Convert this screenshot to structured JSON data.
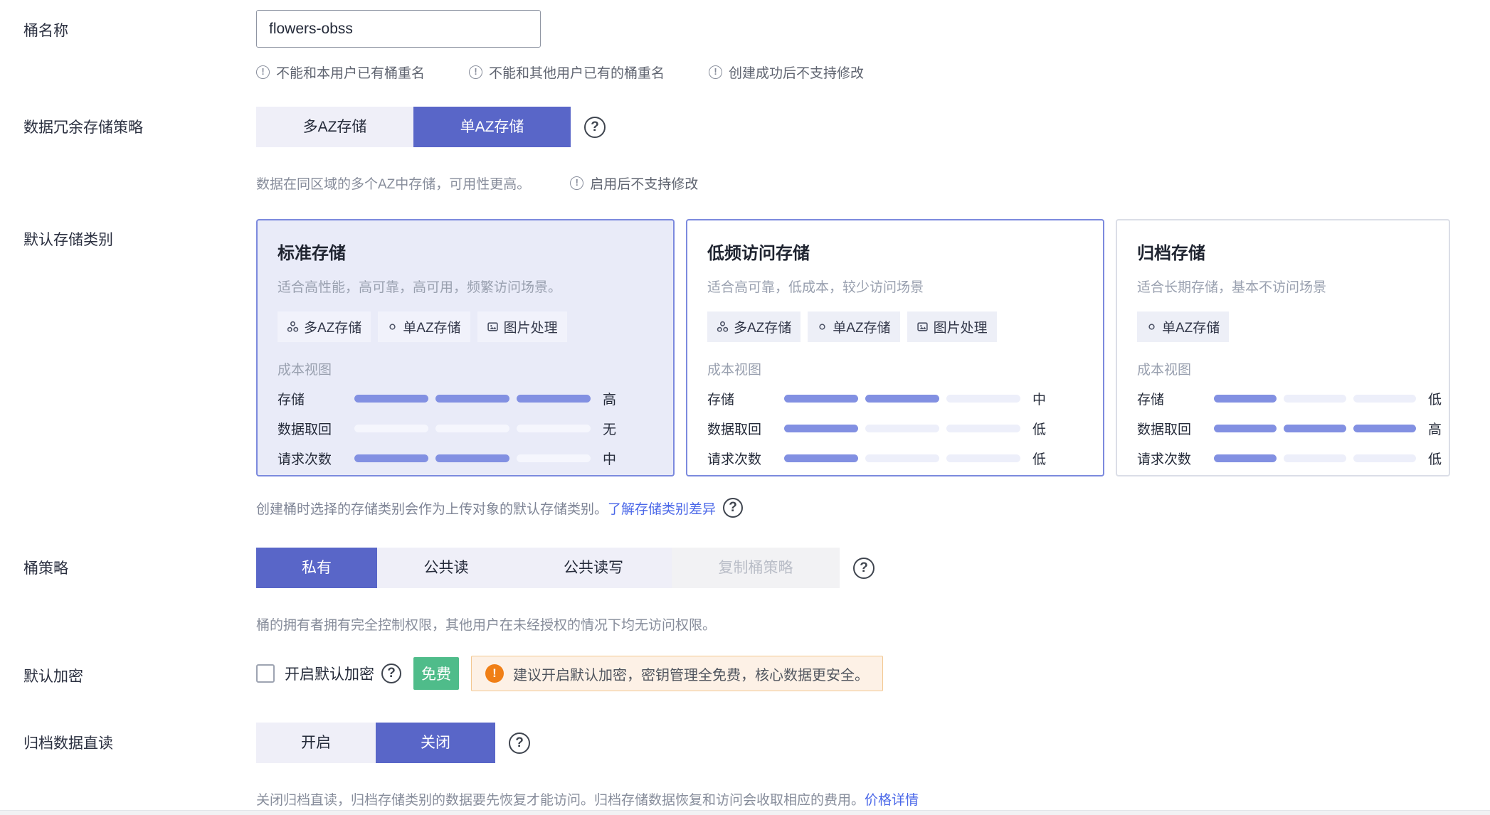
{
  "colors": {
    "accent": "#5966c8",
    "bar_fill": "#8290e2",
    "link": "#4a67e8",
    "badge_green": "#4fbc8a",
    "warning_orange": "#f07f16"
  },
  "icons": {
    "info_glyph": "!",
    "help_glyph": "?",
    "warning_glyph": "!",
    "tag_icons": [
      "multi-az-icon",
      "single-az-icon",
      "image-processing-icon"
    ]
  },
  "form": {
    "bucket_name": {
      "label": "桶名称",
      "value": "flowers-obss",
      "hints": [
        "不能和本用户已有桶重名",
        "不能和其他用户已有的桶重名",
        "创建成功后不支持修改"
      ]
    },
    "redundancy": {
      "label": "数据冗余存储策略",
      "options": [
        {
          "label": "多AZ存储",
          "selected": false
        },
        {
          "label": "单AZ存储",
          "selected": true
        }
      ],
      "desc": "数据在同区域的多个AZ中存储，可用性更高。",
      "note": "启用后不支持修改"
    },
    "storage_class": {
      "label": "默认存储类别",
      "cost_view_label": "成本视图",
      "cards": [
        {
          "title": "标准存储",
          "desc": "适合高性能，高可靠，高可用，频繁访问场景。",
          "selected": true,
          "tags": [
            {
              "icon": "multi-az",
              "label": "多AZ存储"
            },
            {
              "icon": "single-az",
              "label": "单AZ存储"
            },
            {
              "icon": "image-processing",
              "label": "图片处理"
            }
          ],
          "costs": [
            {
              "name": "存储",
              "level": 3,
              "level_text": "高"
            },
            {
              "name": "数据取回",
              "level": 0,
              "level_text": "无"
            },
            {
              "name": "请求次数",
              "level": 2,
              "level_text": "中"
            }
          ]
        },
        {
          "title": "低频访问存储",
          "desc": "适合高可靠，低成本，较少访问场景",
          "selected": false,
          "tags": [
            {
              "icon": "multi-az",
              "label": "多AZ存储"
            },
            {
              "icon": "single-az",
              "label": "单AZ存储"
            },
            {
              "icon": "image-processing",
              "label": "图片处理"
            }
          ],
          "costs": [
            {
              "name": "存储",
              "level": 2,
              "level_text": "中"
            },
            {
              "name": "数据取回",
              "level": 1,
              "level_text": "低"
            },
            {
              "name": "请求次数",
              "level": 1,
              "level_text": "低"
            }
          ]
        },
        {
          "title": "归档存储",
          "desc": "适合长期存储，基本不访问场景",
          "selected": false,
          "tags": [
            {
              "icon": "single-az",
              "label": "单AZ存储"
            }
          ],
          "costs": [
            {
              "name": "存储",
              "level": 1,
              "level_text": "低"
            },
            {
              "name": "数据取回",
              "level": 3,
              "level_text": "高"
            },
            {
              "name": "请求次数",
              "level": 1,
              "level_text": "低"
            }
          ]
        }
      ],
      "footnote": "创建桶时选择的存储类别会作为上传对象的默认存储类别。",
      "footnote_link": "了解存储类别差异"
    },
    "policy": {
      "label": "桶策略",
      "options": [
        {
          "label": "私有",
          "selected": true,
          "disabled": false
        },
        {
          "label": "公共读",
          "selected": false,
          "disabled": false
        },
        {
          "label": "公共读写",
          "selected": false,
          "disabled": false
        },
        {
          "label": "复制桶策略",
          "selected": false,
          "disabled": true
        }
      ],
      "desc": "桶的拥有者拥有完全控制权限，其他用户在未经授权的情况下均无访问权限。"
    },
    "encryption": {
      "label": "默认加密",
      "checkbox_label": "开启默认加密",
      "checked": false,
      "badge": "免费",
      "warning": "建议开启默认加密，密钥管理全免费，核心数据更安全。"
    },
    "archive_read": {
      "label": "归档数据直读",
      "options": [
        {
          "label": "开启",
          "selected": false
        },
        {
          "label": "关闭",
          "selected": true
        }
      ],
      "desc": "关闭归档直读，归档存储类别的数据要先恢复才能访问。归档存储数据恢复和访问会收取相应的费用。",
      "link": "价格详情"
    }
  }
}
